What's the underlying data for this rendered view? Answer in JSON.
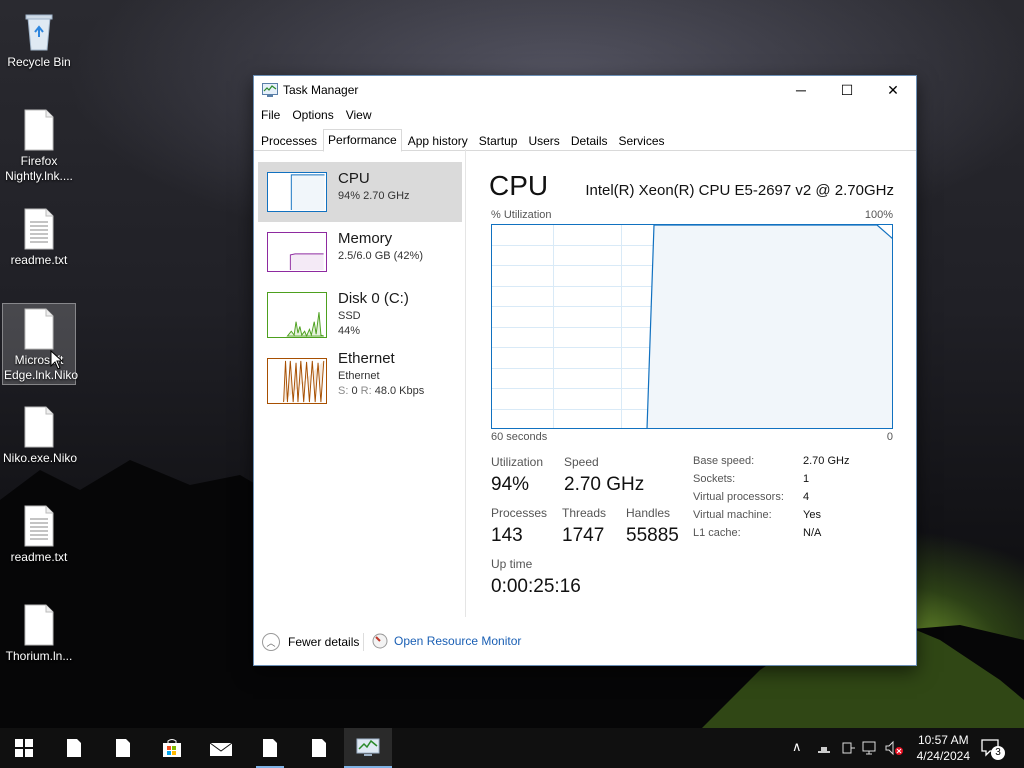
{
  "desktop": {
    "icons": [
      {
        "label": "Recycle Bin",
        "icon": "recycle-bin-icon"
      },
      {
        "label": "Firefox Nightly.lnk....",
        "icon": "file-icon"
      },
      {
        "label": "readme.txt",
        "icon": "text-file-icon"
      },
      {
        "label": "Microsoft Edge.lnk.Niko",
        "icon": "file-icon"
      },
      {
        "label": "Niko.exe.Niko",
        "icon": "file-icon"
      },
      {
        "label": "readme.txt",
        "icon": "text-file-icon"
      },
      {
        "label": "Thorium.ln...",
        "icon": "file-icon"
      }
    ]
  },
  "window": {
    "title": "Task Manager",
    "minimize": "─",
    "maximize": "☐",
    "close": "✕",
    "menu": [
      "File",
      "Options",
      "View"
    ],
    "tabs": [
      "Processes",
      "Performance",
      "App history",
      "Startup",
      "Users",
      "Details",
      "Services"
    ],
    "active_tab": "Performance"
  },
  "resources": [
    {
      "title": "CPU",
      "sub1": "94%  2.70 GHz",
      "color": "#1171c0"
    },
    {
      "title": "Memory",
      "sub1": "2.5/6.0 GB (42%)",
      "color": "#8e2aa0"
    },
    {
      "title": "Disk 0 (C:)",
      "sub1": "SSD",
      "sub2": "44%",
      "color": "#4da01e"
    },
    {
      "title": "Ethernet",
      "sub1": "Ethernet",
      "sub2_s": "S:",
      "sub2_s_val": "0",
      "sub2_r": "R:",
      "sub2_r_val": "48.0 Kbps",
      "color": "#a74f01"
    }
  ],
  "cpu": {
    "heading": "CPU",
    "model": "Intel(R) Xeon(R) CPU E5-2697 v2 @ 2.70GHz",
    "util_label": "% Utilization",
    "util_max": "100%",
    "time_label": "60 seconds",
    "time_zero": "0",
    "stats": {
      "utilization_label": "Utilization",
      "utilization": "94%",
      "speed_label": "Speed",
      "speed": "2.70 GHz",
      "processes_label": "Processes",
      "processes": "143",
      "threads_label": "Threads",
      "threads": "1747",
      "handles_label": "Handles",
      "handles": "55885",
      "uptime_label": "Up time",
      "uptime": "0:00:25:16"
    },
    "specs": [
      {
        "label": "Base speed:",
        "value": "2.70 GHz"
      },
      {
        "label": "Sockets:",
        "value": "1"
      },
      {
        "label": "Virtual processors:",
        "value": "4"
      },
      {
        "label": "Virtual machine:",
        "value": "Yes"
      },
      {
        "label": "L1 cache:",
        "value": "N/A"
      }
    ],
    "accent": "#1171c0",
    "fill": "#f1f6fa"
  },
  "footer": {
    "fewer_details": "Fewer details",
    "open_resource_monitor": "Open Resource Monitor"
  },
  "taskbar": {
    "clock_time": "10:57 AM",
    "clock_date": "4/24/2024",
    "notification_count": "3"
  }
}
